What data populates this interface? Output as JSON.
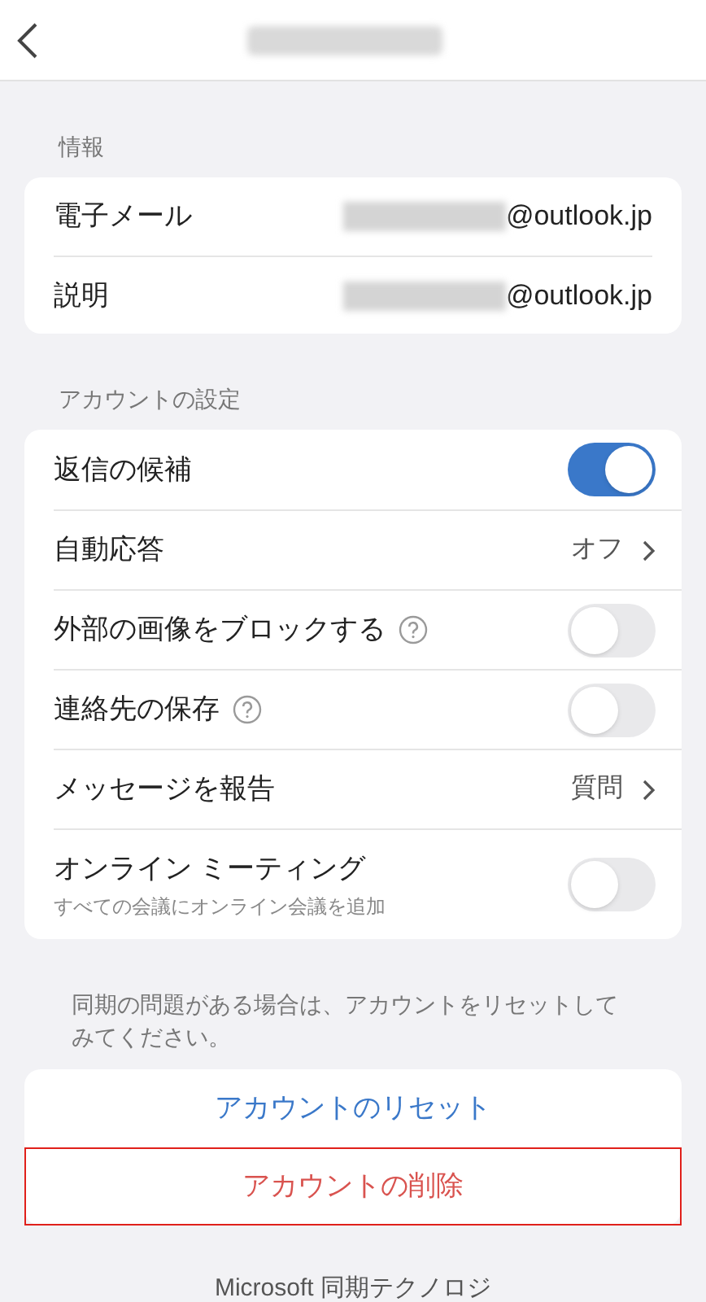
{
  "info": {
    "heading": "情報",
    "rows": [
      {
        "label": "電子メール",
        "value": "@outlook.jp"
      },
      {
        "label": "説明",
        "value": "@outlook.jp"
      }
    ]
  },
  "settings": {
    "heading": "アカウントの設定",
    "rows": [
      {
        "kind": "toggle",
        "label": "返信の候補",
        "on": true,
        "help": false
      },
      {
        "kind": "value",
        "label": "自動応答",
        "value": "オフ"
      },
      {
        "kind": "toggle",
        "label": "外部の画像をブロックする",
        "on": false,
        "help": true
      },
      {
        "kind": "toggle",
        "label": "連絡先の保存",
        "on": false,
        "help": true
      },
      {
        "kind": "value",
        "label": "メッセージを報告",
        "value": "質問"
      },
      {
        "kind": "toggle",
        "label": "オンライン ミーティング",
        "sublabel": "すべての会議にオンライン会議を追加",
        "on": false,
        "help": false
      }
    ]
  },
  "sync_note": "同期の問題がある場合は、アカウントをリセットしてみてください。",
  "actions": [
    {
      "kind": "reset",
      "label": "アカウントのリセット",
      "highlighted": false
    },
    {
      "kind": "delete",
      "label": "アカウントの削除",
      "highlighted": true
    }
  ],
  "footer": "Microsoft 同期テクノロジ"
}
